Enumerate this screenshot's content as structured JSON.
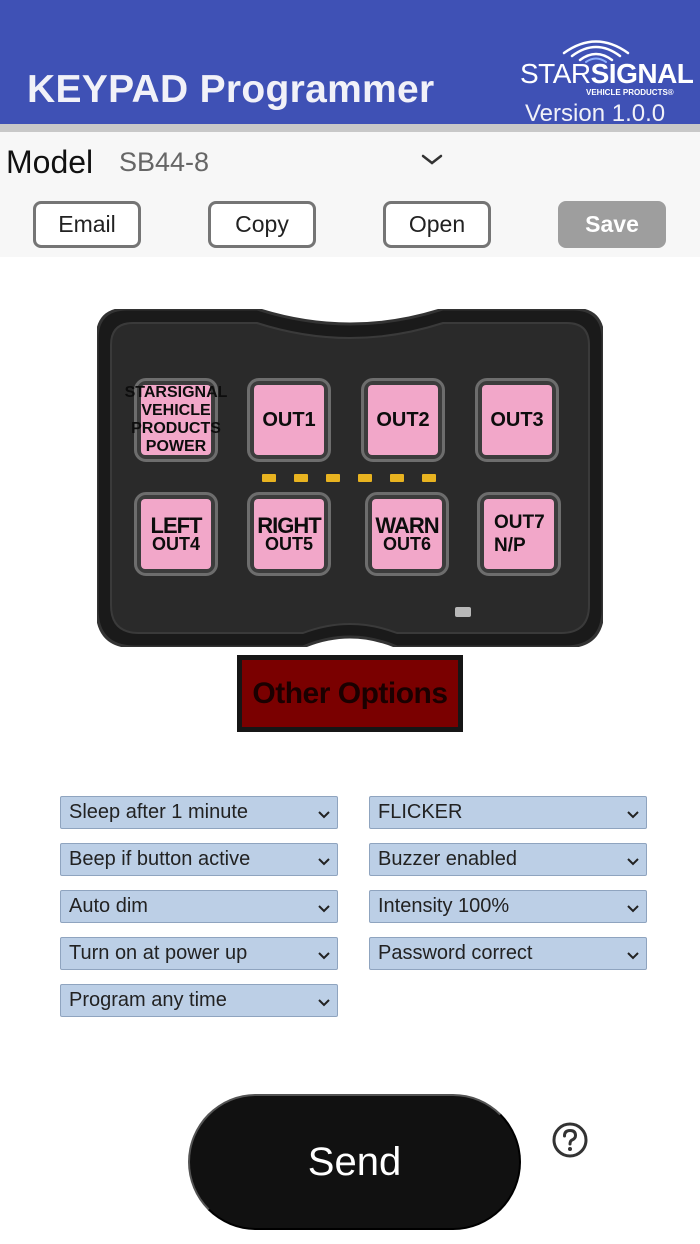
{
  "header": {
    "title": "KEYPAD Programmer",
    "logo": {
      "star": "STAR",
      "signal": "SIGNAL",
      "sub": "VEHICLE PRODUCTS®"
    },
    "version": "Version 1.0.0",
    "bg_color": "#3f51b5"
  },
  "toolbar": {
    "model_label": "Model",
    "model_value": "SB44-8",
    "email_label": "Email",
    "copy_label": "Copy",
    "open_label": "Open",
    "save_label": "Save"
  },
  "keypad": {
    "power_key": {
      "brand": "STARSIGNAL",
      "brand_sub": "VEHICLE PRODUCTS",
      "label": "POWER"
    },
    "keys": [
      {
        "label": "OUT1"
      },
      {
        "label": "OUT2"
      },
      {
        "label": "OUT3"
      },
      {
        "line1": "LEFT",
        "line2": "OUT4"
      },
      {
        "line1": "RIGHT",
        "line2": "OUT5"
      },
      {
        "line1": "WARN",
        "line2": "OUT6"
      },
      {
        "line1": "OUT7",
        "line2": "N/P"
      }
    ],
    "key_color": "#f2a7c9",
    "led_color": "#e8b320"
  },
  "other_options": {
    "label": "Other Options",
    "color": "#7a0000"
  },
  "options": {
    "left": [
      "Sleep after 1 minute",
      "Beep if button active",
      "Auto dim",
      "Turn on at power up",
      "Program any time"
    ],
    "right": [
      "FLICKER",
      "Buzzer enabled",
      "Intensity 100%",
      "Password correct"
    ],
    "bg_color": "#bccfe6"
  },
  "send": {
    "label": "Send"
  },
  "icons": [
    "chevron-down-icon",
    "help-circle-icon",
    "signal-waves-icon"
  ]
}
